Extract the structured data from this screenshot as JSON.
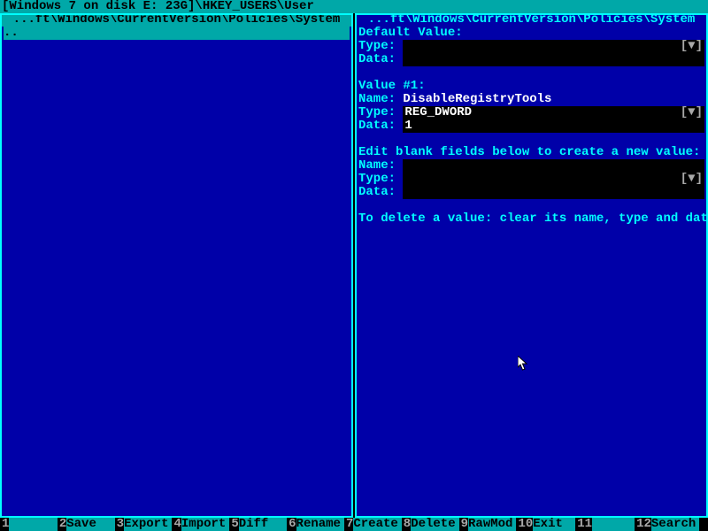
{
  "titlebar": "[Windows 7 on disk E: 23G]\\HKEY_USERS\\User",
  "left_panel": {
    "title": " ...ft\\Windows\\CurrentVersion\\Policies\\System ",
    "active": true,
    "items": [
      ".."
    ]
  },
  "right_panel": {
    "title": " ...ft\\Windows\\CurrentVersion\\Policies\\System ",
    "active": false,
    "default_value": {
      "header": "Default Value:",
      "type_label": "Type:",
      "data_label": "Data:",
      "type_value": "",
      "data_value": "",
      "dropdown": "[▼]"
    },
    "value1": {
      "header": "Value #1:",
      "name_label": "Name:",
      "type_label": "Type:",
      "data_label": "Data:",
      "name_value": "DisableRegistryTools",
      "type_value": "REG_DWORD",
      "data_value": "1",
      "dropdown": "[▼]"
    },
    "new_value": {
      "header": "Edit blank fields below to create a new value:",
      "name_label": "Name:",
      "type_label": "Type:",
      "data_label": "Data:",
      "name_value": "",
      "type_value": "",
      "data_value": "",
      "dropdown": "[▼]"
    },
    "delete_hint": "To delete a value: clear its name, type and data"
  },
  "fkeys": [
    {
      "n": "1",
      "label": "      "
    },
    {
      "n": "2",
      "label": "Save  "
    },
    {
      "n": "3",
      "label": "Export"
    },
    {
      "n": "4",
      "label": "Import"
    },
    {
      "n": "5",
      "label": "Diff  "
    },
    {
      "n": "6",
      "label": "Rename"
    },
    {
      "n": "7",
      "label": "Create"
    },
    {
      "n": "8",
      "label": "Delete"
    },
    {
      "n": "9",
      "label": "RawMod"
    },
    {
      "n": "10",
      "label": "Exit "
    },
    {
      "n": "11",
      "label": "     "
    },
    {
      "n": "12",
      "label": "Search"
    }
  ]
}
